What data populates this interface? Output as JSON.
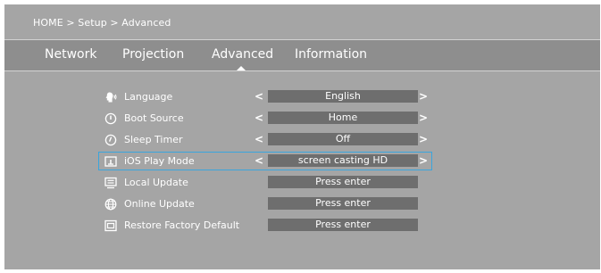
{
  "breadcrumb": "HOME > Setup > Advanced",
  "tabs": [
    {
      "label": "Network",
      "active": false
    },
    {
      "label": "Projection",
      "active": false
    },
    {
      "label": "Advanced",
      "active": true
    },
    {
      "label": "Information",
      "active": false
    }
  ],
  "colors": {
    "background": "#a5a5a5",
    "tab_bar": "#8e8e8e",
    "value_box": "#6e6e6e",
    "selection_accent": "#3aa5dd",
    "text": "#ffffff"
  },
  "settings": [
    {
      "icon": "language-icon",
      "label": "Language",
      "value": "English",
      "has_arrows": true
    },
    {
      "icon": "power-icon",
      "label": "Boot Source",
      "value": "Home",
      "has_arrows": true
    },
    {
      "icon": "clock-icon",
      "label": "Sleep Timer",
      "value": "Off",
      "has_arrows": true
    },
    {
      "icon": "screen-mirror-icon",
      "label": "iOS Play Mode",
      "value": "screen casting HD",
      "has_arrows": true,
      "selected": true
    },
    {
      "icon": "local-update-icon",
      "label": "Local Update",
      "value": "Press enter",
      "has_arrows": false
    },
    {
      "icon": "globe-icon",
      "label": "Online Update",
      "value": "Press enter",
      "has_arrows": false
    },
    {
      "icon": "reset-icon",
      "label": "Restore Factory Default",
      "value": "Press enter",
      "has_arrows": false
    }
  ],
  "arrows": {
    "left": "<",
    "right": ">"
  }
}
